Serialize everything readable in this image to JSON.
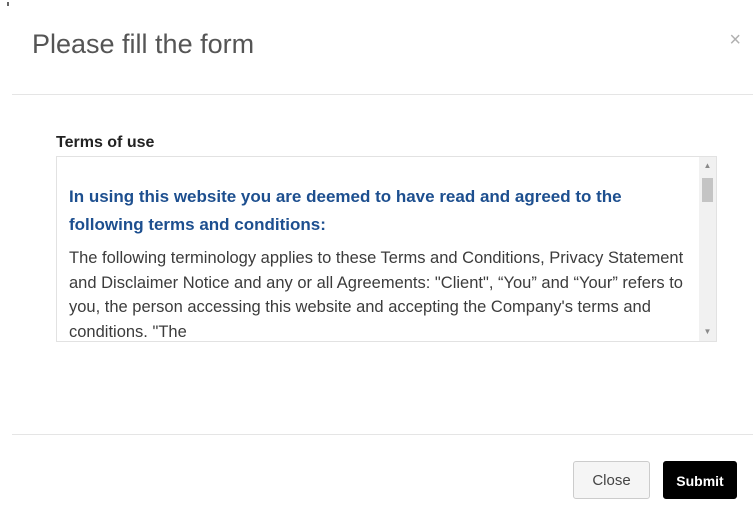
{
  "modal": {
    "title": "Please fill the form",
    "close_symbol": "×"
  },
  "form": {
    "terms_label": "Terms of use",
    "terms_heading": "In using this website you are deemed to have read and agreed to the following terms and conditions:",
    "terms_body": "The following terminology applies to these Terms and Conditions, Privacy Statement and Disclaimer Notice and any or all Agreements: \"Client\", “You” and “Your” refers to you, the person accessing this website and accepting the Company's terms and conditions. \"The"
  },
  "footer": {
    "close_label": "Close",
    "submit_label": "Submit"
  },
  "icons": {
    "close": "close-icon",
    "scroll_up": "scroll-up-arrow-icon",
    "scroll_down": "scroll-down-arrow-icon"
  },
  "colors": {
    "heading": "#1d4f8f",
    "submit_bg": "#000000",
    "title": "#555555"
  }
}
